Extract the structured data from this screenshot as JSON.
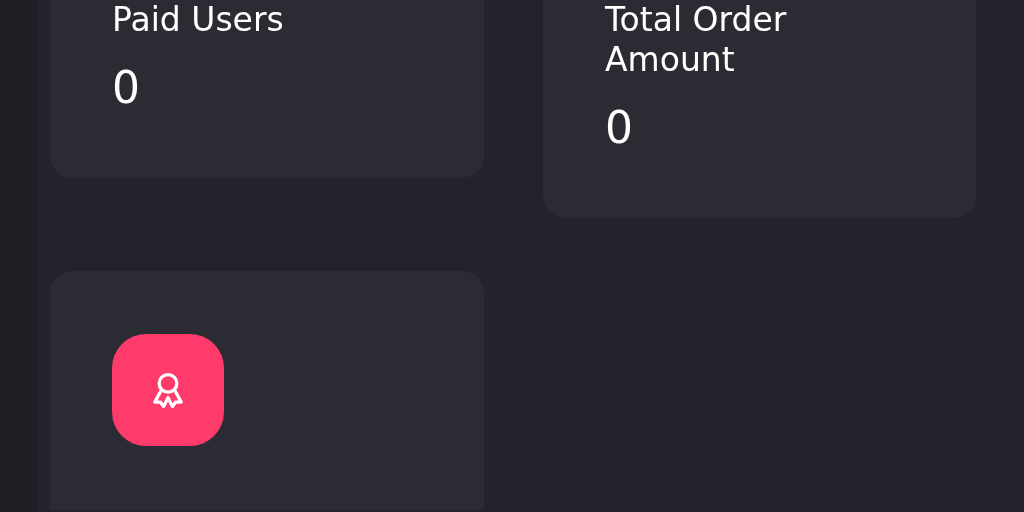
{
  "cards": [
    {
      "kind": "stat",
      "title": "Paid Users",
      "value": "0"
    },
    {
      "kind": "stat",
      "title": "Total Order Amount",
      "value": "0"
    },
    {
      "kind": "icon"
    }
  ]
}
